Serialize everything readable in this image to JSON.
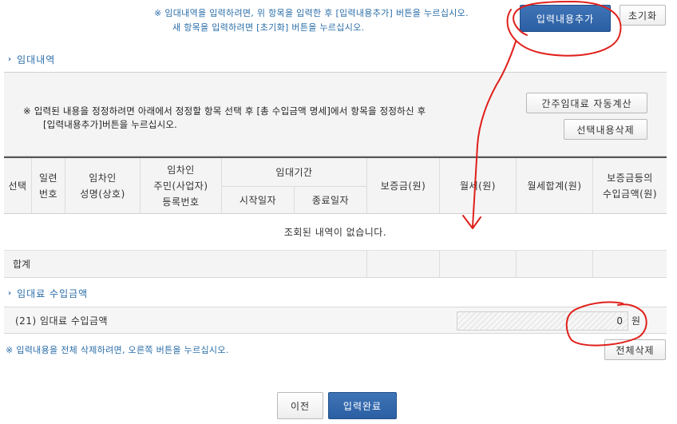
{
  "top": {
    "notice_line1": "※ 임대내역을 입력하려면, 위 항목을 입력한 후 [입력내용추가] 버튼을 누르십시오.",
    "notice_line2": "새 항목을 입력하려면 [초기화] 버튼을 누르십시오.",
    "add_button": "입력내용추가",
    "reset_button": "초기화"
  },
  "rental_section": {
    "title": "임대내역",
    "edit_notice_line1": "※ 입력된 내용을 정정하려면 아래에서 정정할 항목 선택 후 [총 수입금액 명세]에서 항목을 정정하신 후",
    "edit_notice_line2": "[입력내용추가]버튼을 누르십시오.",
    "auto_calc_button": "간주임대료 자동계산",
    "delete_selected_button": "선택내용삭제"
  },
  "table": {
    "headers": {
      "select": "선택",
      "serial_1": "일련",
      "serial_2": "번호",
      "tenant_name_1": "임차인",
      "tenant_name_2": "성명(상호)",
      "tenant_id_1": "임차인",
      "tenant_id_2": "주민(사업자)",
      "tenant_id_3": "등록번호",
      "period": "임대기간",
      "start_date": "시작일자",
      "end_date": "종료일자",
      "deposit": "보증금(원)",
      "monthly_rent": "월세(원)",
      "monthly_total": "월세합계(원)",
      "deposit_income_1": "보증금등의",
      "deposit_income_2": "수입금액(원)"
    },
    "empty_message": "조회된 내역이 없습니다.",
    "sum_label": "합계"
  },
  "income_section": {
    "title": "임대료 수입금액",
    "row_label": "(21) 임대료 수입금액",
    "value": "0",
    "unit": "원"
  },
  "bottom": {
    "delete_all_notice": "※ 입력내용을 전체 삭제하려면, 오른쪽 버튼을 누르십시오.",
    "delete_all_button": "전체삭제",
    "prev_button": "이전",
    "done_button": "입력완료"
  },
  "colors": {
    "primary": "#2a5fa3",
    "notice_text": "#2a6da8",
    "annotation": "#e0201b"
  }
}
